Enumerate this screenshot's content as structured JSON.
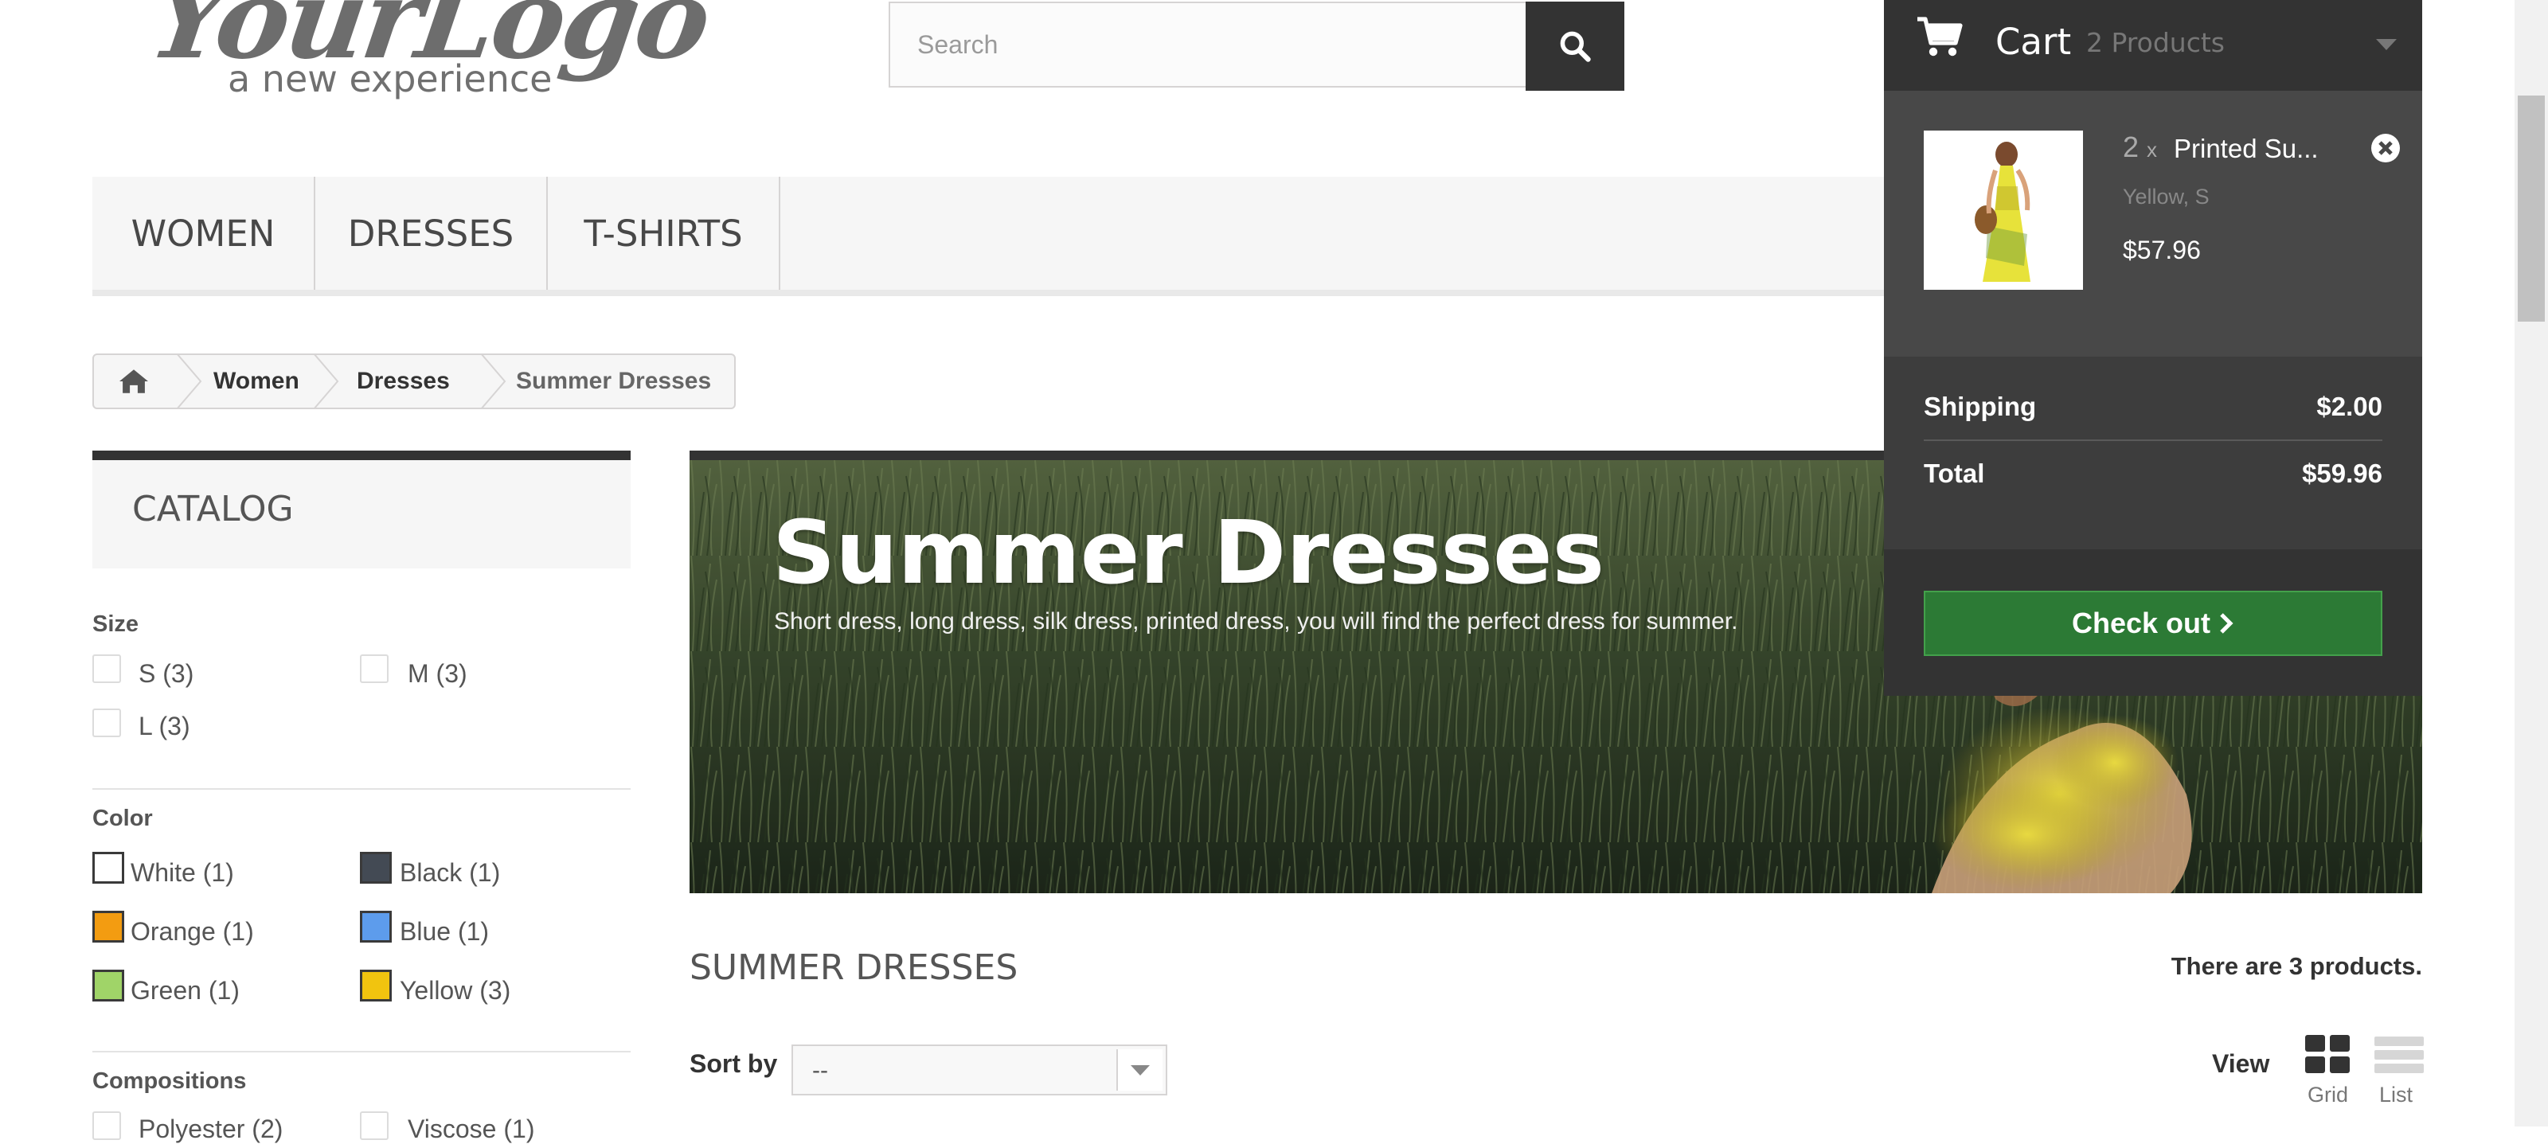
{
  "logo": {
    "script_text": "YourLogo",
    "tagline": "a new experience"
  },
  "search": {
    "placeholder": "Search",
    "button_icon": "search-icon"
  },
  "menu": {
    "items": [
      "Women",
      "Dresses",
      "T-shirts"
    ]
  },
  "breadcrumb": {
    "home_icon": "home-icon",
    "items": [
      "Women",
      "Dresses"
    ],
    "current": "Summer Dresses"
  },
  "catalog": {
    "title": "CATALOG",
    "size": {
      "title": "Size",
      "options": [
        "S (3)",
        "M (3)",
        "L (3)"
      ]
    },
    "color": {
      "title": "Color",
      "options": [
        {
          "label": "White (1)",
          "color": "#ffffff"
        },
        {
          "label": "Black (1)",
          "color": "#434a54"
        },
        {
          "label": "Orange (1)",
          "color": "#f39c11"
        },
        {
          "label": "Blue (1)",
          "color": "#5d9cec"
        },
        {
          "label": "Green (1)",
          "color": "#a0d468"
        },
        {
          "label": "Yellow (3)",
          "color": "#f1c40f"
        }
      ]
    },
    "compositions": {
      "title": "Compositions",
      "options": [
        "Polyester (2)",
        "Viscose (1)"
      ]
    }
  },
  "banner": {
    "title": "Summer Dresses",
    "description": "Short dress, long dress, silk dress, printed dress, you will find the perfect dress for summer."
  },
  "category": {
    "heading": "Summer Dresses",
    "product_count": "There are 3 products."
  },
  "sort": {
    "label": "Sort by",
    "value": "--"
  },
  "view": {
    "label": "View",
    "grid": "Grid",
    "list": "List"
  },
  "cart": {
    "title": "Cart",
    "count": "2 Products",
    "item": {
      "qty": "2",
      "qty_suffix": "x",
      "name": "Printed Su...",
      "attributes": "Yellow, S",
      "price": "$57.96"
    },
    "shipping_label": "Shipping",
    "shipping_value": "$2.00",
    "total_label": "Total",
    "total_value": "$59.96",
    "checkout_label": "Check out"
  },
  "colors": {
    "dark": "#333333",
    "checkout_green": "#2c7a35",
    "cart_bg": "#484848"
  }
}
